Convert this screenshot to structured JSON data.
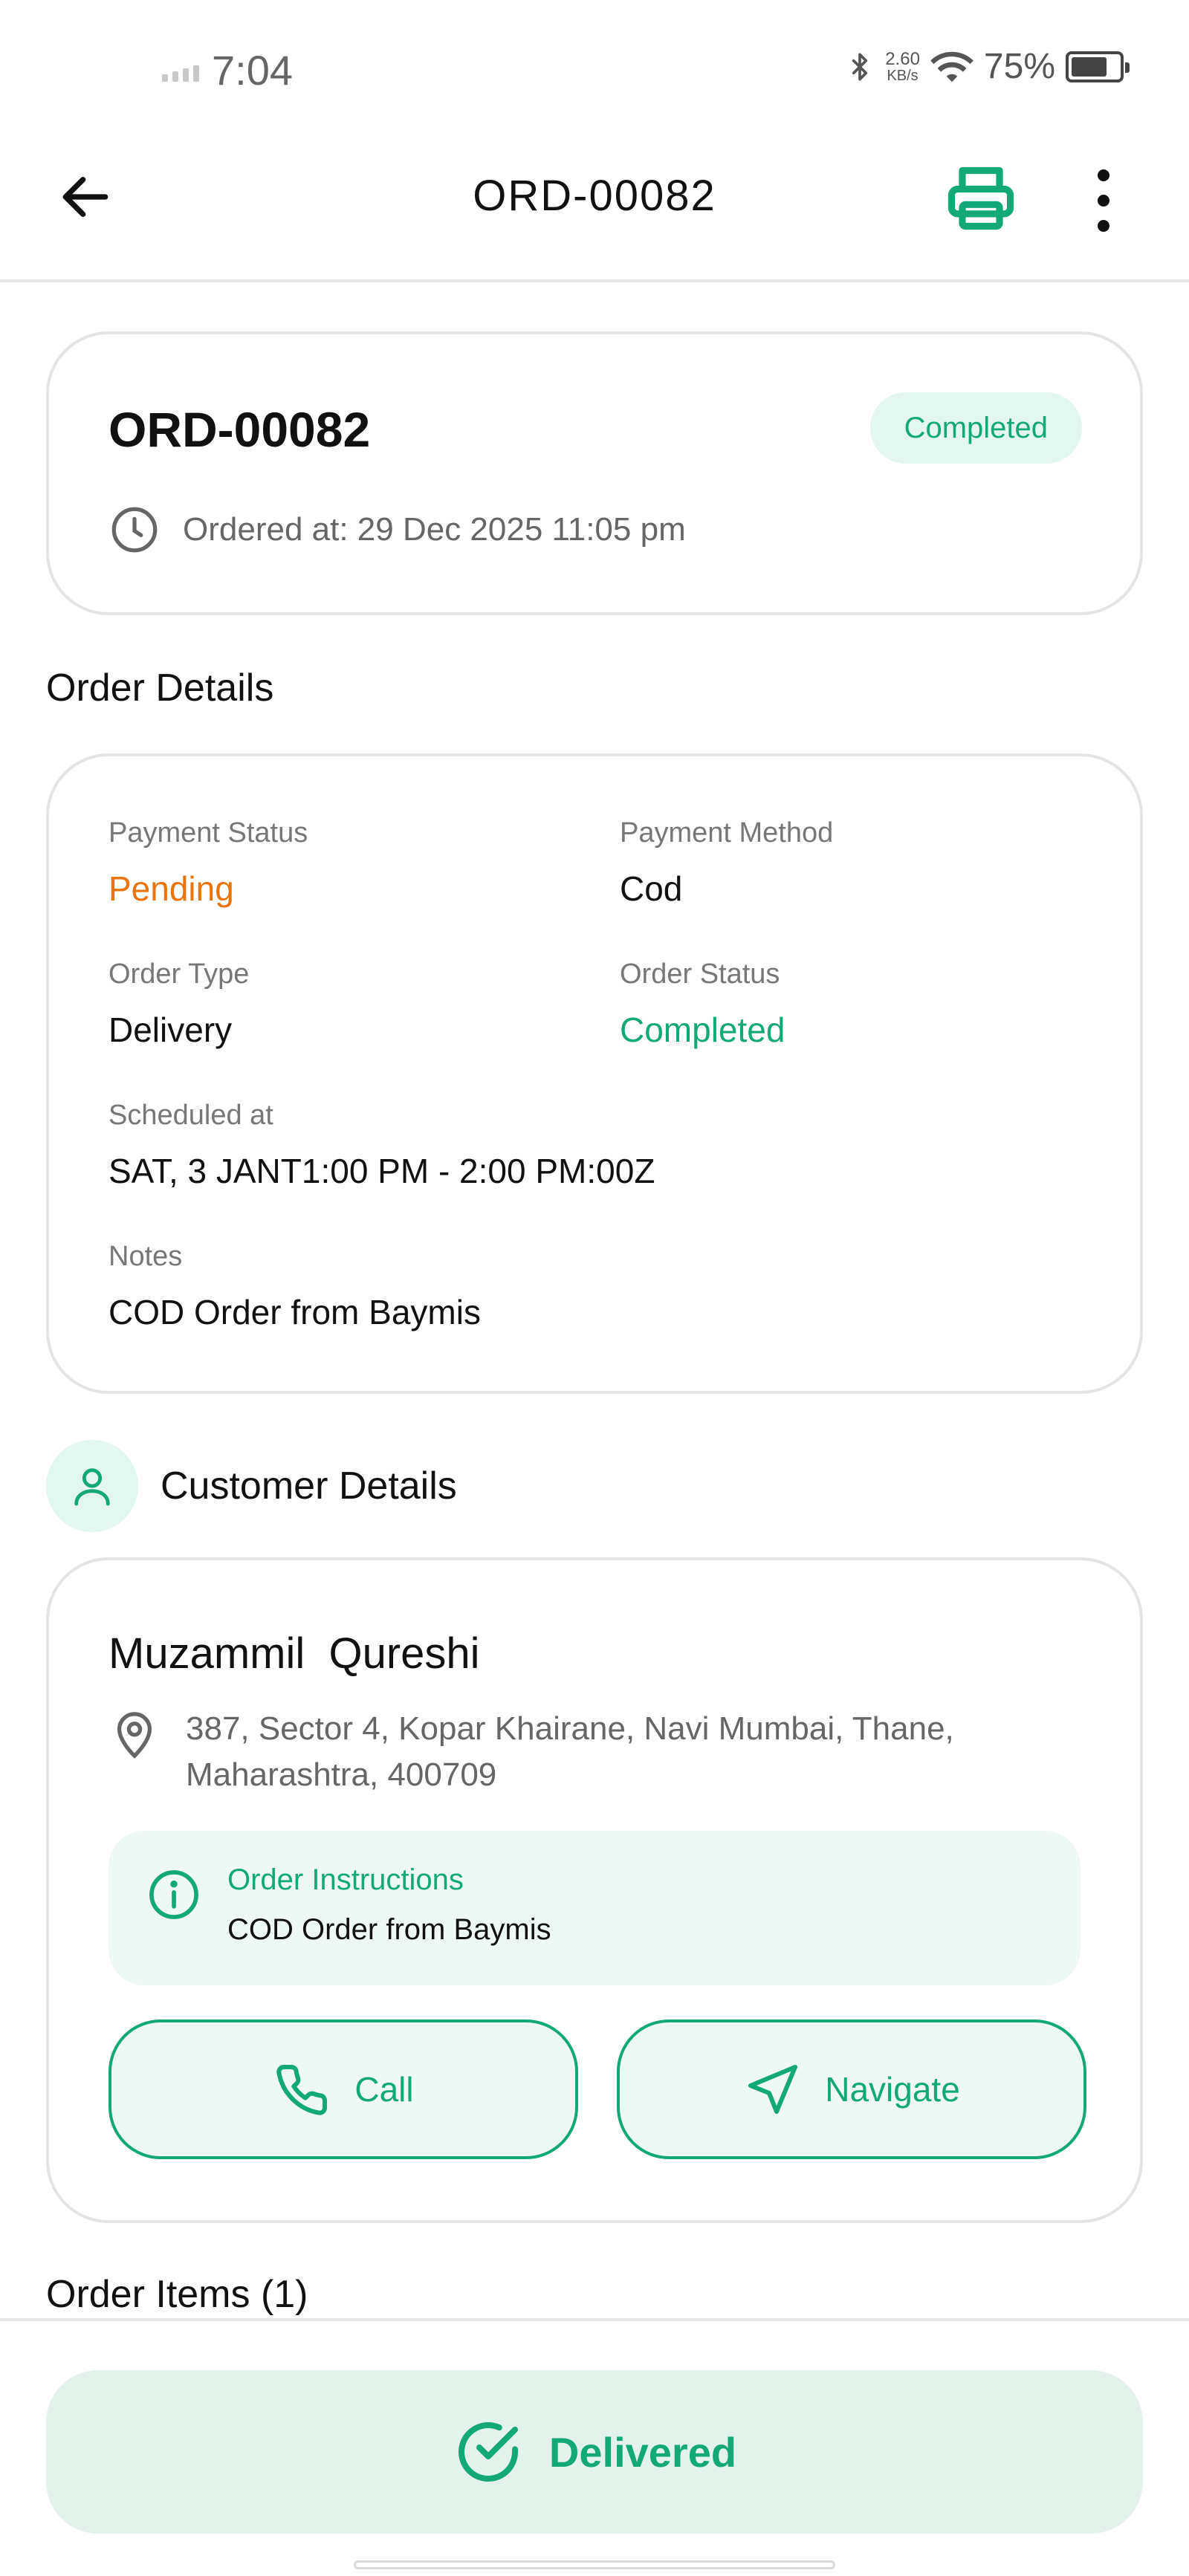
{
  "status_bar": {
    "time": "7:04",
    "net_speed": "2.60",
    "net_unit": "KB/s",
    "battery": "75%",
    "battery_level": 0.75
  },
  "app_bar": {
    "title": "ORD-00082"
  },
  "order_header": {
    "order_id": "ORD-00082",
    "status_badge": "Completed",
    "ordered_at": "Ordered at: 29 Dec 2025 11:05 pm"
  },
  "order_details": {
    "section_title": "Order Details",
    "payment_status_label": "Payment Status",
    "payment_status_value": "Pending",
    "payment_method_label": "Payment Method",
    "payment_method_value": "Cod",
    "order_type_label": "Order Type",
    "order_type_value": "Delivery",
    "order_status_label": "Order Status",
    "order_status_value": "Completed",
    "scheduled_label": "Scheduled at",
    "scheduled_value": "SAT, 3 JANT1:00 PM - 2:00 PM:00Z",
    "notes_label": "Notes",
    "notes_value": "COD Order from Baymis"
  },
  "customer_details": {
    "section_title": "Customer Details",
    "name": "Muzammil  Qureshi",
    "address": "387, Sector 4, Kopar Khairane, Navi Mumbai, Thane, Maharashtra, 400709",
    "instructions_title": "Order Instructions",
    "instructions_text": "COD Order from Baymis",
    "call_label": "Call",
    "navigate_label": "Navigate"
  },
  "order_items": {
    "section_title": "Order Items (1)"
  },
  "bottom": {
    "delivered_label": "Delivered"
  },
  "colors": {
    "accent_green": "#12a877",
    "pending_orange": "#e8750b",
    "badge_bg": "#e3f6ef"
  },
  "icons": [
    "back-arrow-icon",
    "printer-icon",
    "more-vert-icon",
    "clock-icon",
    "person-icon",
    "location-pin-icon",
    "info-icon",
    "phone-icon",
    "navigation-icon",
    "check-circle-icon",
    "bluetooth-icon",
    "wifi-icon",
    "battery-icon",
    "signal-icon"
  ]
}
